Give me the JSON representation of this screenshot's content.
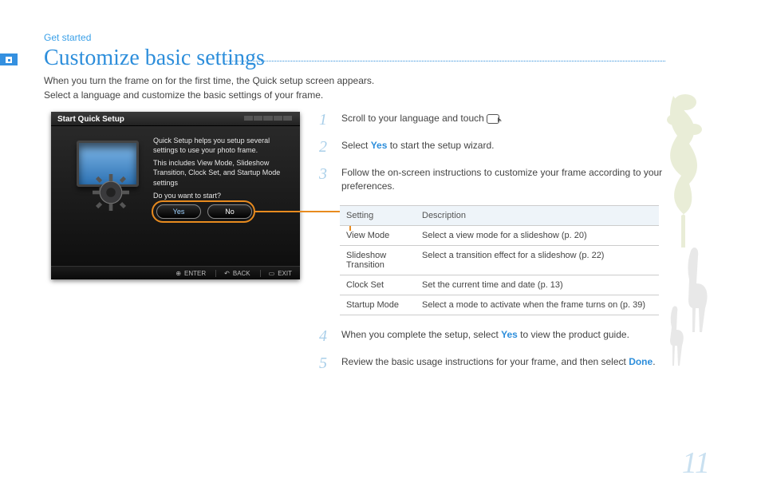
{
  "header": {
    "section": "Get started",
    "title": "Customize basic settings",
    "intro_line1": "When you turn the frame on for the first time, the Quick setup screen appears.",
    "intro_line2": "Select a language and customize the basic settings of your frame."
  },
  "screenshot": {
    "title": "Start Quick Setup",
    "body_line1": "Quick Setup helps you setup several settings to use your photo frame.",
    "body_line2": "This includes View Mode, Slideshow Transition, Clock Set, and Startup Mode settings",
    "body_line3": "Do you want to start?",
    "yes": "Yes",
    "no": "No",
    "footer_enter": "ENTER",
    "footer_back": "BACK",
    "footer_exit": "EXIT"
  },
  "steps": {
    "n1": "1",
    "t1_a": "Scroll to your language and touch ",
    "t1_b": ".",
    "n2": "2",
    "t2_a": "Select ",
    "t2_bold": "Yes",
    "t2_b": " to start the setup wizard.",
    "n3": "3",
    "t3": "Follow the on-screen instructions to customize your frame according to your preferences.",
    "n4": "4",
    "t4_a": "When you complete the setup, select ",
    "t4_bold": "Yes",
    "t4_b": " to view the product guide.",
    "n5": "5",
    "t5_a": "Review the basic usage instructions for your frame, and then select ",
    "t5_bold": "Done",
    "t5_b": "."
  },
  "table": {
    "head_setting": "Setting",
    "head_desc": "Description",
    "rows": [
      {
        "name": "View Mode",
        "desc": "Select a view mode for a slideshow (p. 20)"
      },
      {
        "name": "Slideshow Transition",
        "desc": "Select a transition effect for a slideshow (p. 22)"
      },
      {
        "name": "Clock Set",
        "desc": "Set the current time and date (p. 13)"
      },
      {
        "name": "Startup Mode",
        "desc": "Select a mode to activate when the frame turns on (p. 39)"
      }
    ]
  },
  "page_number": "11"
}
